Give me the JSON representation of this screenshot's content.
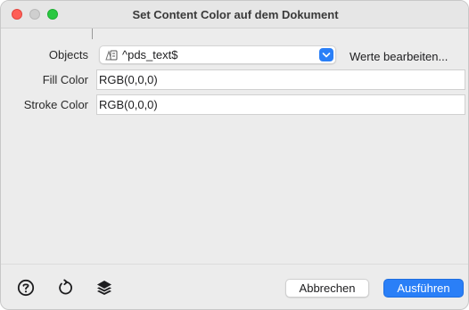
{
  "window": {
    "title": "Set Content Color auf dem Dokument"
  },
  "form": {
    "objects_label": "Objects",
    "objects_value": "^pds_text$",
    "edit_values_label": "Werte bearbeiten...",
    "fill_label": "Fill Color",
    "fill_value": "RGB(0,0,0)",
    "stroke_label": "Stroke Color",
    "stroke_value": "RGB(0,0,0)"
  },
  "footer": {
    "cancel_label": "Abbrechen",
    "run_label": "Ausführen",
    "icons": [
      "help-icon",
      "reload-icon",
      "layers-icon"
    ]
  },
  "colors": {
    "accent": "#2a7ff7",
    "close": "#fe5f57",
    "maximize": "#29c840"
  }
}
